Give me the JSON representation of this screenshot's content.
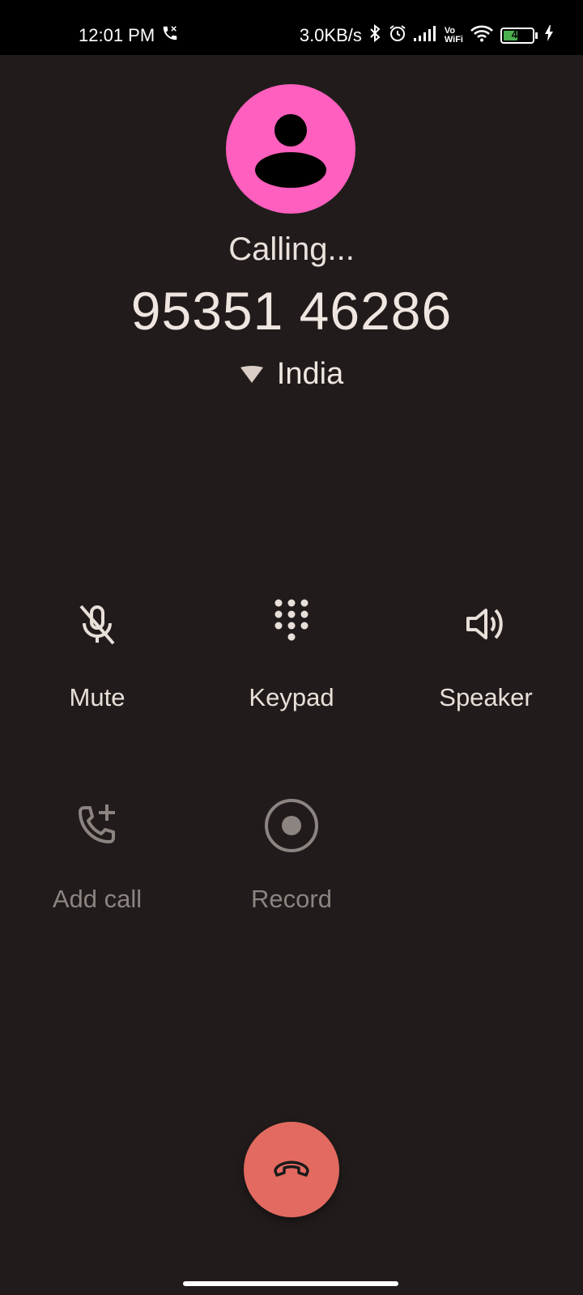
{
  "status_bar": {
    "time": "12:01 PM",
    "network_speed": "3.0KB/s",
    "volte_top": "Vo",
    "volte_bottom": "WiFi",
    "battery_level": "44"
  },
  "call": {
    "status": "Calling...",
    "number": "95351 46286",
    "location": "India"
  },
  "actions": {
    "mute": "Mute",
    "keypad": "Keypad",
    "speaker": "Speaker",
    "add_call": "Add call",
    "record": "Record"
  },
  "colors": {
    "background": "#211c1b",
    "avatar": "#ff5fbe",
    "end_call": "#e36a60",
    "text": "#e8dfd9",
    "disabled_text": "#8c8480"
  },
  "icons": {
    "status_call": "wifi-call-icon",
    "bluetooth": "bluetooth-icon",
    "alarm": "alarm-icon",
    "signal": "signal-icon",
    "wifi": "wifi-icon",
    "charging": "charging-icon",
    "mute": "mic-off-icon",
    "keypad": "dialpad-icon",
    "speaker": "speaker-icon",
    "add_call": "add-call-icon",
    "record": "record-icon",
    "end_call": "end-call-icon"
  }
}
